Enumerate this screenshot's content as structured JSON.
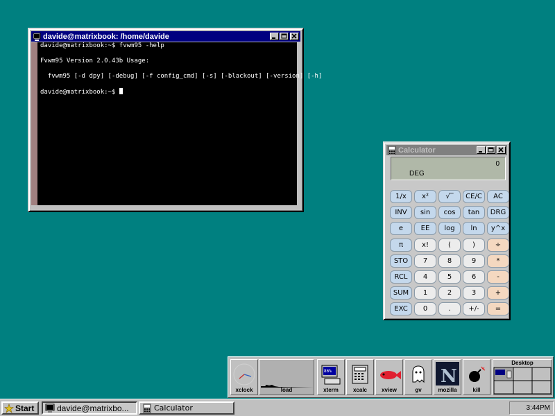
{
  "terminal": {
    "title": "davide@matrixbook: /home/davide",
    "lines": [
      "davide@matrixbook:~$ fvwm95 -help",
      "",
      "Fvwm95 Version 2.0.43b Usage:",
      "",
      "  fvwm95 [-d dpy] [-debug] [-f config_cmd] [-s] [-blackout] [-version] [-h]",
      "",
      "davide@matrixbook:~$ "
    ]
  },
  "calculator": {
    "title": "Calculator",
    "display_value": "0",
    "display_mode": "DEG",
    "buttons": [
      [
        "1/x",
        "x²",
        "√‾",
        "CE/C",
        "AC"
      ],
      [
        "INV",
        "sin",
        "cos",
        "tan",
        "DRG"
      ],
      [
        "e",
        "EE",
        "log",
        "ln",
        "y^x"
      ],
      [
        "π",
        "x!",
        "(",
        ")",
        "÷"
      ],
      [
        "STO",
        "7",
        "8",
        "9",
        "*"
      ],
      [
        "RCL",
        "4",
        "5",
        "6",
        "-"
      ],
      [
        "SUM",
        "1",
        "2",
        "3",
        "+"
      ],
      [
        "EXC",
        "0",
        ".",
        "+/-",
        "="
      ]
    ],
    "colors": {
      "blue": "#c4d8ec",
      "white": "#ececec",
      "orange": "#f4d8c0"
    }
  },
  "wharf": {
    "items": [
      {
        "label": "xclock",
        "icon": "clock-icon"
      },
      {
        "label": "load",
        "icon": "load-graph-icon"
      },
      {
        "label": "xterm",
        "icon": "terminal-icon"
      },
      {
        "label": "xcalc",
        "icon": "calculator-icon"
      },
      {
        "label": "xview",
        "icon": "fish-icon"
      },
      {
        "label": "gv",
        "icon": "ghost-icon"
      },
      {
        "label": "mozilla",
        "icon": "netscape-icon"
      },
      {
        "label": "kill",
        "icon": "bomb-icon"
      }
    ],
    "pager_label": "Desktop"
  },
  "taskbar": {
    "start_label": "Start",
    "tasks": [
      {
        "label": "davide@matrixbo...",
        "active": true
      },
      {
        "label": "Calculator",
        "active": false
      }
    ],
    "clock": "3:44PM"
  },
  "colors": {
    "desktop": "#008080",
    "active_title": "#000080",
    "inactive_title": "#808080"
  }
}
